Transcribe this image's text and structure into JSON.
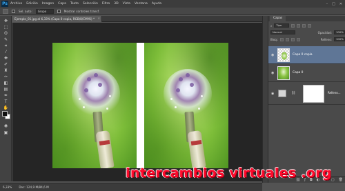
{
  "app": {
    "logo": "Ps"
  },
  "menubar": {
    "items": [
      "Archivo",
      "Edición",
      "Imagen",
      "Capa",
      "Texto",
      "Selección",
      "Filtro",
      "3D",
      "Vista",
      "Ventana",
      "Ayuda"
    ],
    "window_controls": [
      "–",
      "□",
      "✕"
    ]
  },
  "options_bar": {
    "label": "Sel. auto:",
    "dropdown_value": "Grupo",
    "checkbox_label": "Mostrar controles transf."
  },
  "document": {
    "tab_label": "Ejemplo_01.jpg al 6,33% (Capa 0 copia, RGB/8/CMYK) *",
    "second_tab_label": "",
    "status_zoom": "6,33%",
    "status_doc": "Doc: 124,9 M/84,6 M"
  },
  "layers_panel": {
    "tab_label": "Capas",
    "filter_label": "Tipo",
    "blend_mode": "Normal",
    "opacity_label": "Opacidad:",
    "opacity_value": "100%",
    "lock_label": "Bloq.:",
    "fill_label": "Relleno:",
    "fill_value": "100%",
    "layers": [
      {
        "name": "Capa 0 copia",
        "selected": true
      },
      {
        "name": "Capa 0",
        "selected": false
      },
      {
        "name": "Relleno...",
        "selected": false
      }
    ],
    "footer_icons": [
      "link-icon",
      "fx-icon",
      "mask-icon",
      "adjustment-icon",
      "folder-icon",
      "new-layer-icon",
      "trash-icon"
    ]
  },
  "watermark": {
    "text": "intercambios virtuales .org"
  },
  "colors": {
    "accent_selected": "#5f7696",
    "watermark_red": "#ff0a2c"
  }
}
